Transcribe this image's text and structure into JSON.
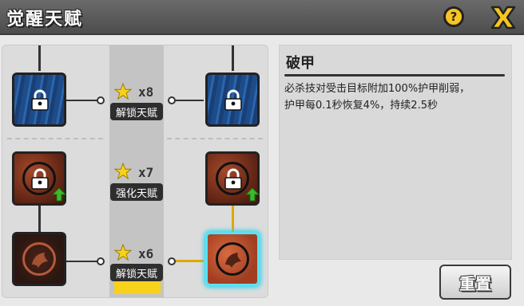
{
  "header": {
    "title": "觉醒天赋",
    "help_label": "?",
    "close_icon": "close-x-icon"
  },
  "colors": {
    "accent_yellow": "#f7c51e",
    "selected_glow": "#34d3ee",
    "pill_bg": "#2e2e2e"
  },
  "talent_tiers": [
    {
      "star_count": "x8",
      "action_label": "解锁天赋",
      "left_state": "locked",
      "right_state": "locked"
    },
    {
      "star_count": "x7",
      "action_label": "强化天赋",
      "left_state": "locked-upgradable",
      "right_state": "locked-upgradable"
    },
    {
      "star_count": "x6",
      "action_label": "解锁天赋",
      "left_state": "unlocked",
      "right_state": "selected"
    }
  ],
  "detail": {
    "name": "破甲",
    "line1": "必杀技对受击目标附加100%护甲削弱，",
    "line2": "护甲每0.1秒恢复4%，持续2.5秒"
  },
  "reset_label": "重置"
}
